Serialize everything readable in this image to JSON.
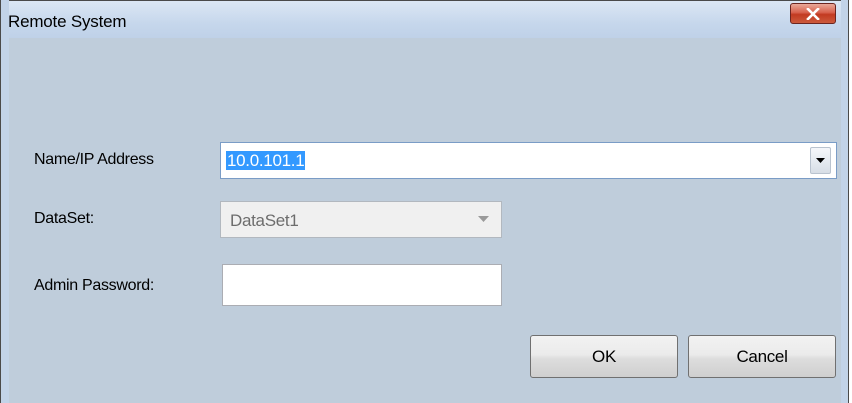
{
  "window": {
    "title": "Remote System"
  },
  "form": {
    "name_ip_label": "Name/IP Address",
    "name_ip_value": "10.0.101.1",
    "dataset_label": "DataSet:",
    "dataset_value": "DataSet1",
    "admin_password_label": "Admin Password:",
    "admin_password_value": ""
  },
  "buttons": {
    "ok_label": "OK",
    "cancel_label": "Cancel"
  },
  "icons": {
    "close": "close-icon",
    "dropdown": "chevron-down-icon"
  },
  "colors": {
    "client_background": "#bfcddb",
    "selection_highlight": "#3399ff",
    "close_button": "#c23a21"
  }
}
